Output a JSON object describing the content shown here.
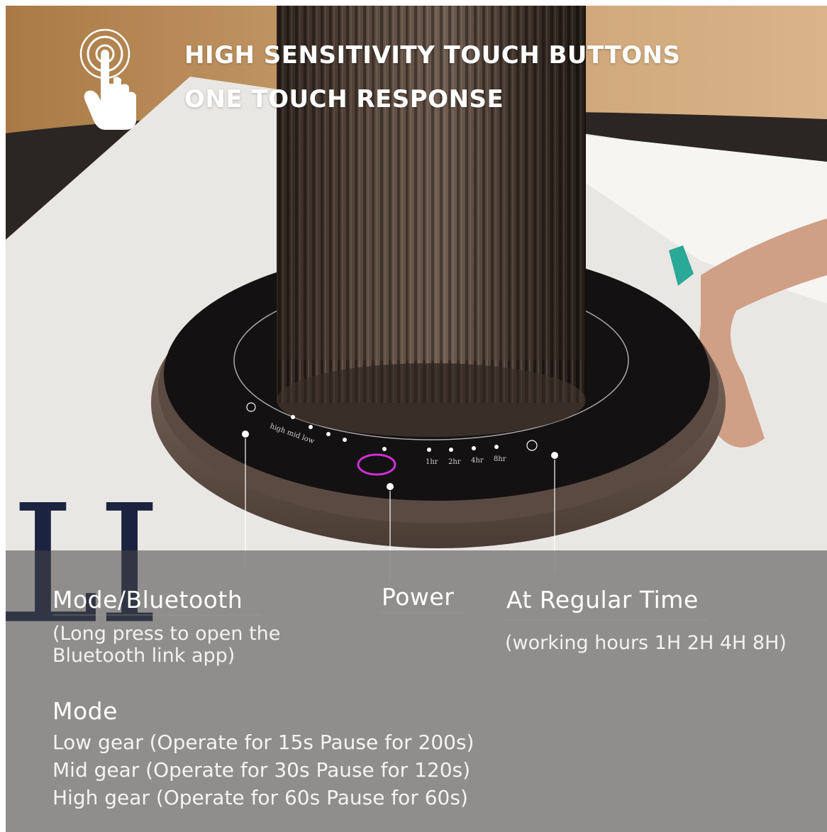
{
  "headline": {
    "line1": "HIGH SENSITIVITY TOUCH BUTTONS",
    "line2": "ONE TOUCH RESPONSE"
  },
  "icons": {
    "touch": "hand-touch-icon"
  },
  "magazine_text": "ITOH",
  "panel_labels": {
    "timer_1": "1hr",
    "timer_2": "2hr",
    "timer_4": "4hr",
    "timer_8": "8hr",
    "mode": "high mid low"
  },
  "callouts": {
    "mode_bluetooth": {
      "title": "Mode/Bluetooth",
      "desc_line1": "(Long press to open the",
      "desc_line2": "Bluetooth link app)"
    },
    "power": {
      "title": "Power"
    },
    "regular_time": {
      "title": "At Regular Time",
      "desc": "(working hours 1H 2H 4H 8H)"
    }
  },
  "mode": {
    "title": "Mode",
    "lines": [
      "Low gear (Operate for 15s Pause for 200s)",
      "Mid gear (Operate for 30s Pause for 120s)",
      "High gear (Operate for 60s Pause for 60s)"
    ]
  },
  "colors": {
    "power_ring": "#d12fd6",
    "accent_tab": "#2aa898"
  }
}
